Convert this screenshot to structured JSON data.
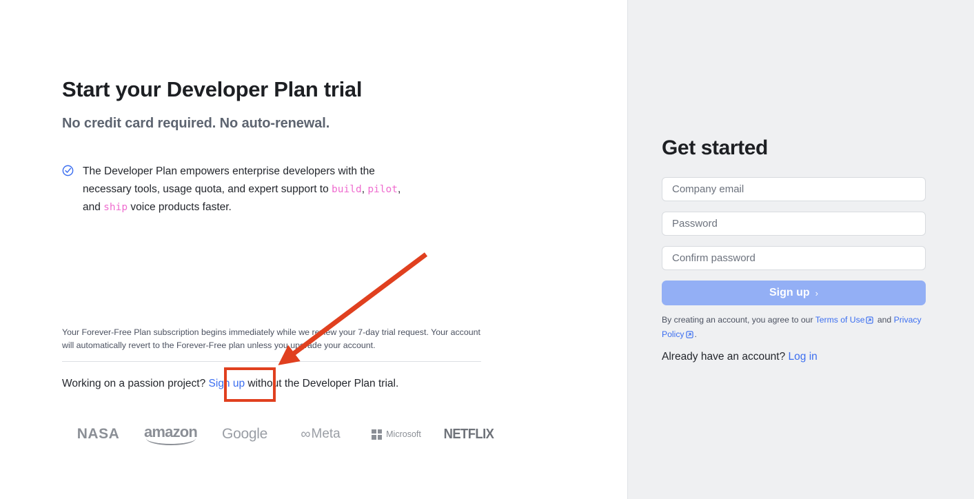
{
  "left": {
    "headline": "Start your Developer Plan trial",
    "subheadline": "No credit card required. No auto-renewal.",
    "bullet": {
      "icon": "check-circle-icon",
      "text_part1": "The Developer Plan empowers enterprise developers with the necessary tools, usage quota, and expert support to ",
      "code1": "build",
      "sep1": ", ",
      "code2": "pilot",
      "sep2": ", and ",
      "code3": "ship",
      "text_part2": " voice products faster."
    },
    "fineprint": "Your Forever-Free Plan subscription begins immediately while we review your 7-day trial request. Your account will automatically revert to the Forever-Free plan unless you upgrade your account.",
    "passion": {
      "prefix": "Working on a passion project? ",
      "link": "Sign up",
      "suffix": " without the Developer Plan trial."
    },
    "logos": [
      {
        "name": "nasa-logo",
        "label": "NASA"
      },
      {
        "name": "amazon-logo",
        "label": "amazon"
      },
      {
        "name": "google-logo",
        "label": "Google"
      },
      {
        "name": "meta-logo",
        "label": "Meta"
      },
      {
        "name": "microsoft-logo",
        "label": "Microsoft"
      },
      {
        "name": "netflix-logo",
        "label": "NETFLIX"
      }
    ]
  },
  "right": {
    "title": "Get started",
    "fields": [
      {
        "name": "company-email-field",
        "placeholder": "Company email",
        "value": ""
      },
      {
        "name": "password-field",
        "placeholder": "Password",
        "value": ""
      },
      {
        "name": "confirm-password-field",
        "placeholder": "Confirm password",
        "value": ""
      }
    ],
    "signup_button": {
      "label": "Sign up",
      "chevron": "›"
    },
    "terms": {
      "prefix": "By creating an account, you agree to our ",
      "terms_link": "Terms of Use",
      "middle": " and ",
      "privacy_link": "Privacy Policy",
      "suffix": "."
    },
    "login": {
      "prompt": "Already have an account? ",
      "link": "Log in"
    }
  },
  "colors": {
    "accent_link": "#3b6ef0",
    "button_bg": "#93aff5",
    "code_pink": "#ef6ccf",
    "check_blue": "#3b6ef0",
    "annotation_red": "#e0401f",
    "panel_bg": "#eff0f2"
  },
  "annotations": {
    "highlight_box_target": "Sign up",
    "arrow": "points from upper-right to the Sign up link"
  }
}
